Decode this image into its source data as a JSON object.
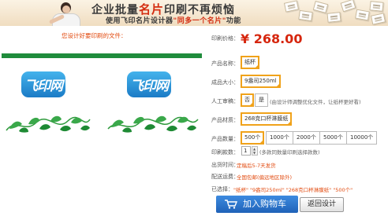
{
  "banner": {
    "title_part1": "企业批量",
    "title_part2": "名片",
    "title_part3": "印刷不再烦恼",
    "subtitle_part1": "使用飞印名片设计器",
    "subtitle_part2": "\"同多一个名片\"",
    "subtitle_part3": "功能"
  },
  "preview": {
    "label": "您设计好要印刷的文件：",
    "logo_text": "飞印网"
  },
  "form": {
    "price_label": "印刷价格：",
    "price_value": "¥ 268.00",
    "name_label": "产品名称：",
    "name_value": "纸杯",
    "size_label": "成品大小：",
    "size_value": "9盎司250ml",
    "review_label": "人工审稿：",
    "review_options": [
      "否",
      "是"
    ],
    "review_selected": "否",
    "review_note": "(由设计师调整优化文件，让纸杯更好看)",
    "material_label": "产品材质：",
    "material_value": "268克口杯淋膜纸",
    "qty_label": "产品数量：",
    "qty_options": [
      "500个",
      "1000个",
      "2000个",
      "5000个",
      "10000个"
    ],
    "qty_selected": "500个",
    "styles_label": "印刷款数：",
    "styles_value": "1",
    "styles_note": "(多款同数量印刷选择款数)",
    "ship_time_label": "出货时间：",
    "ship_time_value": "定稿后5-7天发货",
    "ship_fee_label": "配送运费：",
    "ship_fee_value": "全国包邮(偏远地区除外)",
    "selected_label": "已选择：",
    "selected_value": "\"纸杯\" \"9盎司250ml\" \"268克口杯淋膜纸\" \"500个\"",
    "cart_button": "加入购物车",
    "back_button": "返回设计"
  },
  "colors": {
    "accent_orange": "#f0a21a",
    "price_red": "#d6260e",
    "cart_blue": "#1f62b8"
  }
}
